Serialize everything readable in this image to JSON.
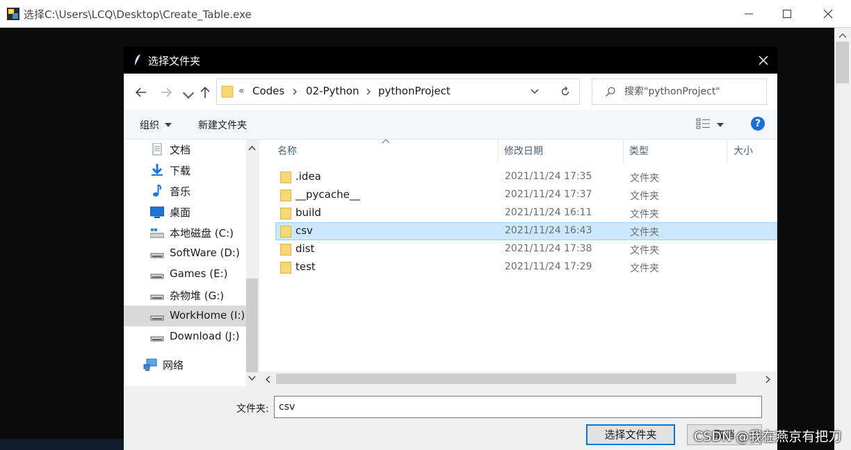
{
  "outer_window": {
    "title": "选择C:\\Users\\LCQ\\Desktop\\Create_Table.exe"
  },
  "dialog": {
    "title": "选择文件夹",
    "address": {
      "overflow": "«",
      "breadcrumbs": [
        "Codes",
        "02-Python",
        "pythonProject"
      ]
    },
    "search": {
      "placeholder": "搜索\"pythonProject\""
    },
    "toolbar": {
      "organize": "组织",
      "new_folder": "新建文件夹",
      "help": "?"
    },
    "nav": [
      {
        "label": "文档",
        "icon": "document-icon"
      },
      {
        "label": "下载",
        "icon": "download-icon"
      },
      {
        "label": "音乐",
        "icon": "music-icon"
      },
      {
        "label": "桌面",
        "icon": "desktop-icon"
      },
      {
        "label": "本地磁盘 (C:)",
        "icon": "system-drive-icon"
      },
      {
        "label": "SoftWare (D:)",
        "icon": "drive-icon"
      },
      {
        "label": "Games (E:)",
        "icon": "drive-icon"
      },
      {
        "label": "杂物堆 (G:)",
        "icon": "drive-icon"
      },
      {
        "label": "WorkHome (I:)",
        "icon": "drive-icon",
        "selected": true
      },
      {
        "label": "Download (J:)",
        "icon": "drive-icon"
      },
      {
        "label": "网络",
        "icon": "network-icon"
      }
    ],
    "columns": {
      "name": "名称",
      "modified": "修改日期",
      "type": "类型",
      "size": "大小"
    },
    "files": [
      {
        "name": ".idea",
        "modified": "2021/11/24 17:35",
        "type": "文件夹"
      },
      {
        "name": "__pycache__",
        "modified": "2021/11/24 17:37",
        "type": "文件夹"
      },
      {
        "name": "build",
        "modified": "2021/11/24 16:11",
        "type": "文件夹"
      },
      {
        "name": "csv",
        "modified": "2021/11/24 16:43",
        "type": "文件夹",
        "selected": true
      },
      {
        "name": "dist",
        "modified": "2021/11/24 17:38",
        "type": "文件夹"
      },
      {
        "name": "test",
        "modified": "2021/11/24 17:29",
        "type": "文件夹"
      }
    ],
    "folder_label": "文件夹:",
    "folder_value": "csv",
    "select_button": "选择文件夹",
    "cancel_button": "取消"
  },
  "watermark": "CSDN @我在燕京有把刀",
  "colors": {
    "accent": "#0078d7",
    "selection": "#cce8ff",
    "folder": "#f8d775",
    "help": "#1a6fd8"
  }
}
